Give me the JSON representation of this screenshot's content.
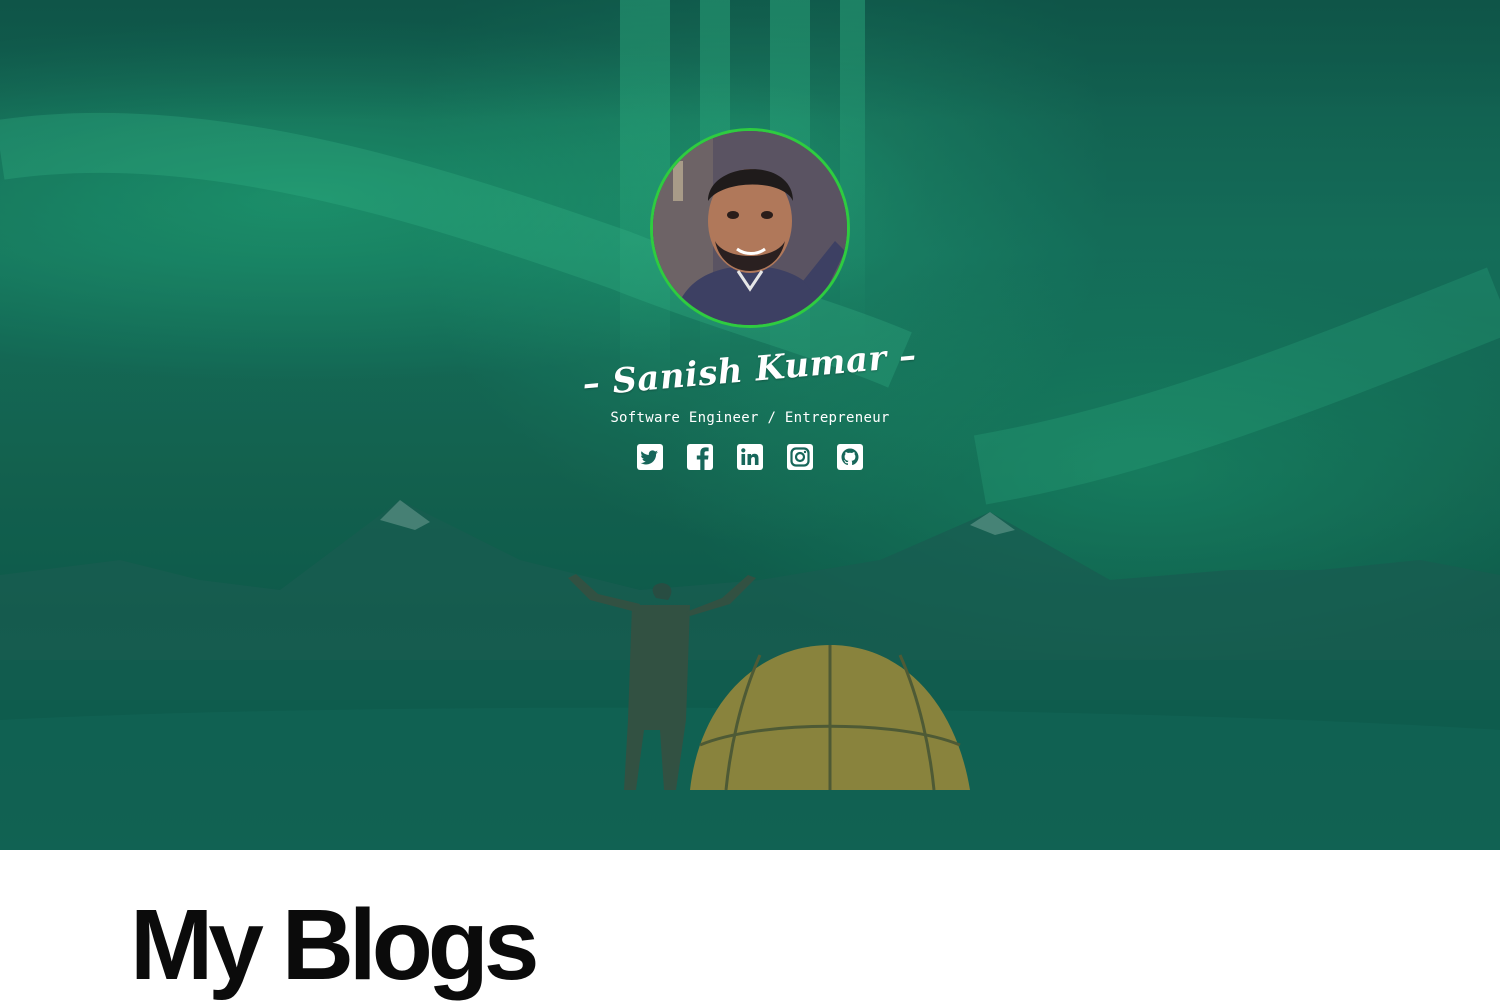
{
  "profile": {
    "name": "– Sanish Kumar –",
    "tagline": "Software Engineer / Entrepreneur"
  },
  "socials": [
    {
      "icon": "twitter-icon"
    },
    {
      "icon": "facebook-icon"
    },
    {
      "icon": "linkedin-icon"
    },
    {
      "icon": "instagram-icon"
    },
    {
      "icon": "github-icon"
    }
  ],
  "section": {
    "title": "My Blogs"
  },
  "colors": {
    "hero_tint": "#16715c",
    "avatar_ring": "#2ecc40",
    "heading": "#0b0b0b"
  }
}
